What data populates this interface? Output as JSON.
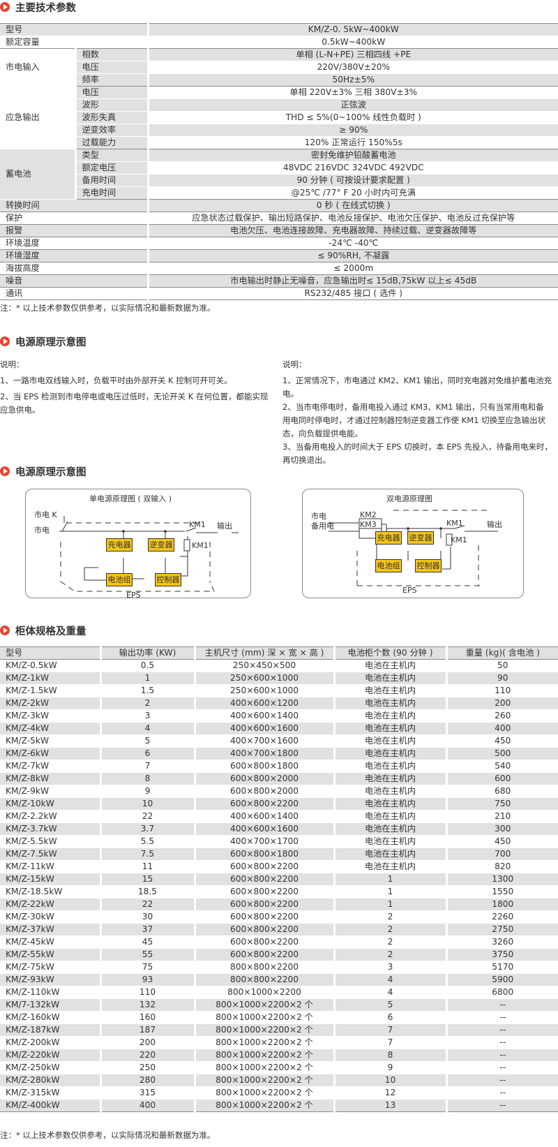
{
  "sections": {
    "specs_title": "主要技术参数",
    "principle_title_1": "电源原理示意图",
    "principle_title_2": "电源原理示意图",
    "cabinet_title": "柜体规格及重量"
  },
  "specs": {
    "model": {
      "label": "型号",
      "value": "KM/Z-0. 5kW~400kW"
    },
    "capacity": {
      "label": "额定容量",
      "value": "0.5kW~400kW"
    },
    "mains_input": {
      "label": "市电输入",
      "rows": [
        {
          "label": "相数",
          "value": "单相 (L-N+PE)  三相四线 +PE"
        },
        {
          "label": "电压",
          "value": "220V/380V±20%"
        },
        {
          "label": "频率",
          "value": "50Hz±5%"
        }
      ]
    },
    "emergency_output": {
      "label": "应急输出",
      "rows": [
        {
          "label": "电压",
          "value": "单相 220V±3%  三相 380V±3%"
        },
        {
          "label": "波形",
          "value": "正弦波"
        },
        {
          "label": "波形失真",
          "value": "THD ≤ 5%(0~100% 线性负载时 )"
        },
        {
          "label": "逆变效率",
          "value": "≥ 90%"
        },
        {
          "label": "过载能力",
          "value": "120% 正常运行  150%5s"
        }
      ]
    },
    "battery": {
      "label": "蓄电池",
      "rows": [
        {
          "label": "类型",
          "value": "密封免维护铅酸蓄电池"
        },
        {
          "label": "额定电压",
          "value": "48VDC  216VDC  324VDC  492VDC"
        },
        {
          "label": "备用时间",
          "value": "90 分钟 ( 可按设计要求配置 )"
        },
        {
          "label": "充电时间",
          "value": "@25℃ /77°  F   20 小时内可充满"
        }
      ]
    },
    "others": [
      {
        "label": "转换时间",
        "value": "0 秒 ( 在线式切换 )"
      },
      {
        "label": "保护",
        "value": "应急状态过载保护、输出短路保护、电池反接保护、电池欠压保护、电池反过充保护等"
      },
      {
        "label": "报警",
        "value": "电池欠压、电池连接故障、充电器故障、持续过载、逆变器故障等"
      },
      {
        "label": "环境温度",
        "value": "-24℃ -40℃"
      },
      {
        "label": "环境湿度",
        "value": "≤ 90%RH, 不凝露"
      },
      {
        "label": "海拔高度",
        "value": "≤ 2000m"
      },
      {
        "label": "噪音",
        "value": "市电输出时静止无噪音，应急输出时≤ 15dB,75kW 以上≤ 45dB"
      },
      {
        "label": "通讯",
        "value": "RS232/485 接口 ( 选件 )"
      }
    ],
    "note": "注：* 以上技术参数仅供参考，以实际情况和最新数据为准。"
  },
  "explanation": {
    "left_title": "说明：",
    "left_lines": [
      "1、一路市电双线输入时，负载平时由外部开关 K 控制可开可关。",
      "2、当 EPS 检测到市电停电或电压过低时，无论开关 K 在何位置，都能实现",
      "应急供电。"
    ],
    "right_title": "说明：",
    "right_lines": [
      "1、正常情况下，市电通过 KM2、KM1 输出，同时充电器对免维护蓄电池充电。",
      "2、当市电停电时，备用电投入通过 KM3、KM1 输出，只有当常用电和备",
      "用电同时停电时，才通过控制器控制逆变器工作使 KM1 切换至应急输出状",
      "态，向负载提供电能。",
      "3、当备用电投入的时间大于 EPS 切换时，本 EPS 先投入，待备用电来时，",
      "再切换退出。"
    ]
  },
  "diagram_single": {
    "title": "单电源原理图 ( 双输入 )",
    "mains_k": "市电 K",
    "mains": "市电",
    "km1_top": "KM1",
    "output": "输出",
    "km1_side": "KM1",
    "charger": "充电器",
    "inverter": "逆变器",
    "battery": "电池组",
    "controller": "控制器",
    "eps": "EPS"
  },
  "diagram_dual": {
    "title": "双电源原理图",
    "mains": "市电",
    "backup": "备用电",
    "km2": "KM2",
    "km3": "KM3",
    "km1_top": "KM1",
    "output": "输出",
    "km1_side": "KM1",
    "charger": "充电器",
    "inverter": "逆变器",
    "battery": "电池组",
    "controller": "控制器",
    "eps": "EPS"
  },
  "cabinet": {
    "headers": [
      "型号",
      "输出功率 (KW)",
      "主机尺寸 (mm) 深 × 宽 × 高 )",
      "电池柜个数 (90 分钟 )",
      "重量 (kg)( 含电池 )"
    ],
    "rows": [
      [
        "KM/Z-0.5kW",
        "0.5",
        "250×450×500",
        "电池在主机内",
        "50"
      ],
      [
        "KM/Z-1kW",
        "1",
        "250×600×1000",
        "电池在主机内",
        "90"
      ],
      [
        "KM/Z-1.5kW",
        "1.5",
        "250×600×1000",
        "电池在主机内",
        "110"
      ],
      [
        "KM/Z-2kW",
        "2",
        "400×600×1200",
        "电池在主机内",
        "200"
      ],
      [
        "KM/Z-3kW",
        "3",
        "400×600×1400",
        "电池在主机内",
        "260"
      ],
      [
        "KM/Z-4kW",
        "4",
        "400×600×1600",
        "电池在主机内",
        "400"
      ],
      [
        "KM/Z-5kW",
        "5",
        "400×700×1600",
        "电池在主机内",
        "450"
      ],
      [
        "KM/Z-6kW",
        "6",
        "400×700×1800",
        "电池在主机内",
        "500"
      ],
      [
        "KM/Z-7kW",
        "7",
        "600×800×1800",
        "电池在主机内",
        "540"
      ],
      [
        "KM/Z-8kW",
        "8",
        "600×800×2000",
        "电池在主机内",
        "600"
      ],
      [
        "KM/Z-9kW",
        "9",
        "600×800×2000",
        "电池在主机内",
        "680"
      ],
      [
        "KM/Z-10kW",
        "10",
        "600×800×2200",
        "电池在主机内",
        "750"
      ],
      [
        "KM/Z-2.2kW",
        "22",
        "400×600×1400",
        "电池在主机内",
        "210"
      ],
      [
        "KM/Z-3.7kW",
        "3.7",
        "400×600×1600",
        "电池在主机内",
        "300"
      ],
      [
        "KM/Z-5.5kW",
        "5.5",
        "400×700×1700",
        "电池在主机内",
        "450"
      ],
      [
        "KM/Z-7.5kW",
        "7.5",
        "600×800×1800",
        "电池在主机内",
        "700"
      ],
      [
        "KM/Z-11kW",
        "11",
        "600×800×2200",
        "电池在主机内",
        "820"
      ],
      [
        "KM/Z-15kW",
        "15",
        "600×800×2200",
        "1",
        "1300"
      ],
      [
        "KM/Z-18.5kW",
        "18.5",
        "600×800×2200",
        "1",
        "1550"
      ],
      [
        "KM/Z-22kW",
        "22",
        "600×800×2200",
        "1",
        "1800"
      ],
      [
        "KM/Z-30kW",
        "30",
        "600×800×2200",
        "2",
        "2260"
      ],
      [
        "KM/Z-37kW",
        "37",
        "600×800×2200",
        "2",
        "2750"
      ],
      [
        "KM/Z-45kW",
        "45",
        "600×800×2200",
        "2",
        "3260"
      ],
      [
        "KM/Z-55kW",
        "55",
        "600×800×2200",
        "2",
        "3750"
      ],
      [
        "KM/Z-75kW",
        "75",
        "800×800×2200",
        "3",
        "5170"
      ],
      [
        "KM/Z-93kW",
        "93",
        "800×800×2200",
        "4",
        "5900"
      ],
      [
        "KM/Z-110kW",
        "110",
        "800×1000×2200",
        "4",
        "6800"
      ],
      [
        "KM/7-132kW",
        "132",
        "800×1000×2200×2 个",
        "5",
        "--"
      ],
      [
        "KM/Z-160kW",
        "160",
        "800×1000×2200×2 个",
        "6",
        "--"
      ],
      [
        "KM/Z-187kW",
        "187",
        "800×1000×2200×2 个",
        "7",
        "--"
      ],
      [
        "KM/Z-200kW",
        "200",
        "800×1000×2200×2 个",
        "7",
        "--"
      ],
      [
        "KM/Z-220kW",
        "220",
        "800×1000×2200×2 个",
        "8",
        "--"
      ],
      [
        "KM/Z-250kW",
        "250",
        "800×1000×2200×2 个",
        "9",
        "--"
      ],
      [
        "KM/Z-280kW",
        "280",
        "800×1000×2200×2 个",
        "10",
        "--"
      ],
      [
        "KM/Z-315kW",
        "315",
        "800×1000×2200×2 个",
        "12",
        "--"
      ],
      [
        "KM/Z-400kW",
        "400",
        "800×1000×2200×2 个",
        "13",
        "--"
      ]
    ],
    "note": "注：* 以上技术参数仅供参考，以实际情况和最新数据为准。"
  }
}
